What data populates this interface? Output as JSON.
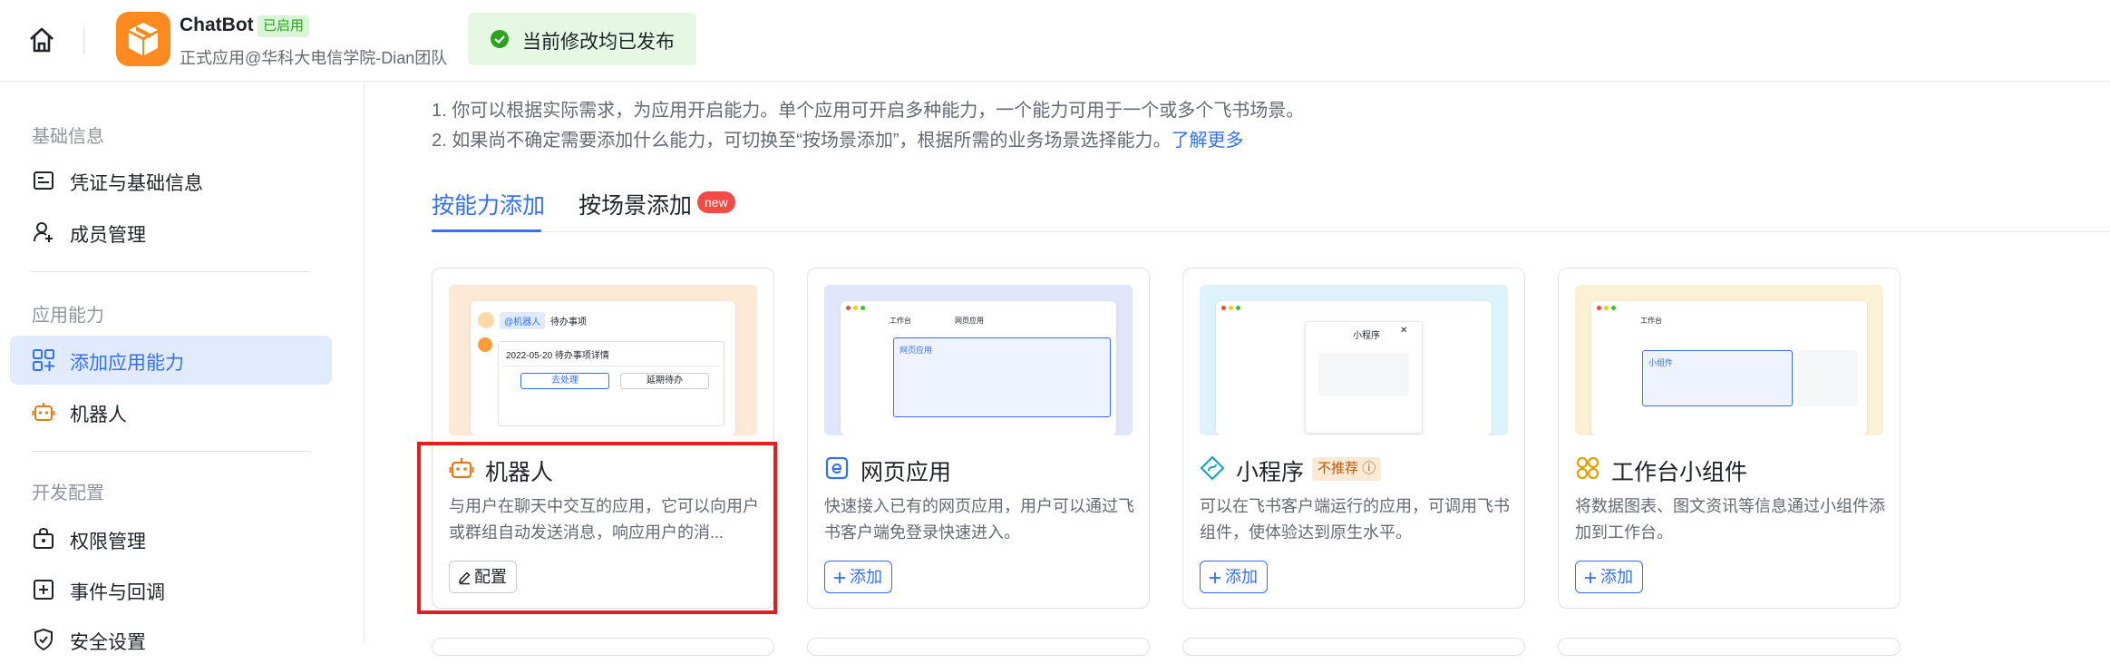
{
  "header": {
    "app_name": "ChatBot",
    "app_status": "已启用",
    "app_subtitle": "正式应用@华科大电信学院-Dian团队",
    "toast": "当前修改均已发布"
  },
  "sidebar": {
    "groups": [
      {
        "title": "基础信息",
        "items": [
          {
            "label": "凭证与基础信息"
          },
          {
            "label": "成员管理"
          }
        ]
      },
      {
        "title": "应用能力",
        "items": [
          {
            "label": "添加应用能力"
          },
          {
            "label": "机器人"
          }
        ]
      },
      {
        "title": "开发配置",
        "items": [
          {
            "label": "权限管理"
          },
          {
            "label": "事件与回调"
          },
          {
            "label": "安全设置"
          }
        ]
      }
    ],
    "active_item": "添加应用能力"
  },
  "main": {
    "tip1": "1. 你可以根据实际需求，为应用开启能力。单个应用可开启多种能力，一个能力可用于一个或多个飞书场景。",
    "tip2": "2. 如果尚不确定需要添加什么能力，可切换至“按场景添加”，根据所需的业务场景选择能力。",
    "tip2_link": "了解更多",
    "tabs": [
      {
        "label": "按能力添加",
        "active": true
      },
      {
        "label": "按场景添加",
        "badge": "new"
      }
    ],
    "cards": [
      {
        "title": "机器人",
        "icon": "robot-icon",
        "desc": "与用户在聊天中交互的应用，它可以向用户或群组自动发送消息，响应用户的消...",
        "button": "配置",
        "button_icon": "edit-icon",
        "preview": {
          "tag1": "@机器人",
          "tag2": "待办事项",
          "line": "2022-05-20 待办事项详情",
          "btn1": "去处理",
          "btn2": "延期待办"
        }
      },
      {
        "title": "网页应用",
        "icon": "web-app-icon",
        "desc": "快速接入已有的网页应用，用户可以通过飞书客户端免登录快速进入。",
        "button": "添加",
        "button_icon": "plus-icon",
        "preview": {
          "tab1": "工作台",
          "tab2": "网页应用",
          "label": "网页应用"
        }
      },
      {
        "title": "小程序",
        "icon": "mini-program-icon",
        "badge": "不推荐",
        "desc": "可以在飞书客户端运行的应用，可调用飞书组件，使体验达到原生水平。",
        "button": "添加",
        "button_icon": "plus-icon",
        "preview": {
          "label": "小程序"
        }
      },
      {
        "title": "工作台小组件",
        "icon": "widget-icon",
        "desc": "将数据图表、图文资讯等信息通过小组件添加到工作台。",
        "button": "添加",
        "button_icon": "plus-icon",
        "preview": {
          "tab1": "工作台",
          "label": "小组件"
        }
      }
    ]
  },
  "colors": {
    "accent": "#3370ff",
    "highlight": "#e02020",
    "success": "#2ea121",
    "danger": "#f54a45"
  }
}
